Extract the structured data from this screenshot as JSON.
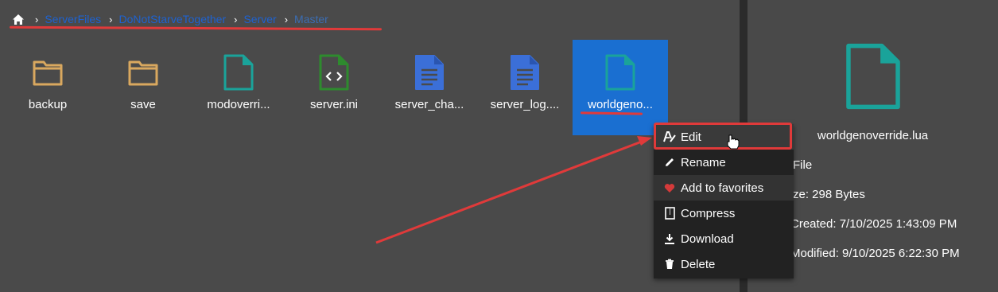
{
  "breadcrumb": {
    "home_icon": "home-icon",
    "items": [
      "ServerFiles",
      "DoNotStarveTogether",
      "Server"
    ],
    "current": "Master"
  },
  "files": [
    {
      "name": "backup",
      "icon": "folder-icon",
      "color": "#d9a85f"
    },
    {
      "name": "save",
      "icon": "folder-icon",
      "color": "#d9a85f"
    },
    {
      "name": "modoverri...",
      "icon": "file-icon",
      "color": "#1aa39a"
    },
    {
      "name": "server.ini",
      "icon": "code-file-icon",
      "color": "#2e8b2e"
    },
    {
      "name": "server_cha...",
      "icon": "text-file-icon",
      "color": "#3b6fd8"
    },
    {
      "name": "server_log....",
      "icon": "text-file-icon",
      "color": "#3b6fd8"
    },
    {
      "name": "worldgeno...",
      "icon": "file-icon",
      "color": "#1aa39a",
      "selected": true
    }
  ],
  "context_menu": {
    "items": [
      {
        "label": "Edit",
        "icon": "edit-text-icon"
      },
      {
        "label": "Rename",
        "icon": "pencil-icon"
      },
      {
        "label": "Add to favorites",
        "icon": "heart-icon"
      },
      {
        "label": "Compress",
        "icon": "archive-icon"
      },
      {
        "label": "Download",
        "icon": "download-icon"
      },
      {
        "label": "Delete",
        "icon": "trash-icon"
      }
    ]
  },
  "details": {
    "file_name": "worldgenoverride.lua",
    "type": "File",
    "size": "ze: 298 Bytes",
    "created": "Created: 7/10/2025 1:43:09 PM",
    "modified": "Modified: 9/10/2025 6:22:30 PM"
  },
  "colors": {
    "accent_selected": "#1a6fd1",
    "annotation_red": "#e03a3a",
    "folder": "#d9a85f",
    "lua_file": "#1aa39a",
    "text_file": "#3b6fd8",
    "code_file": "#2e8b2e"
  }
}
